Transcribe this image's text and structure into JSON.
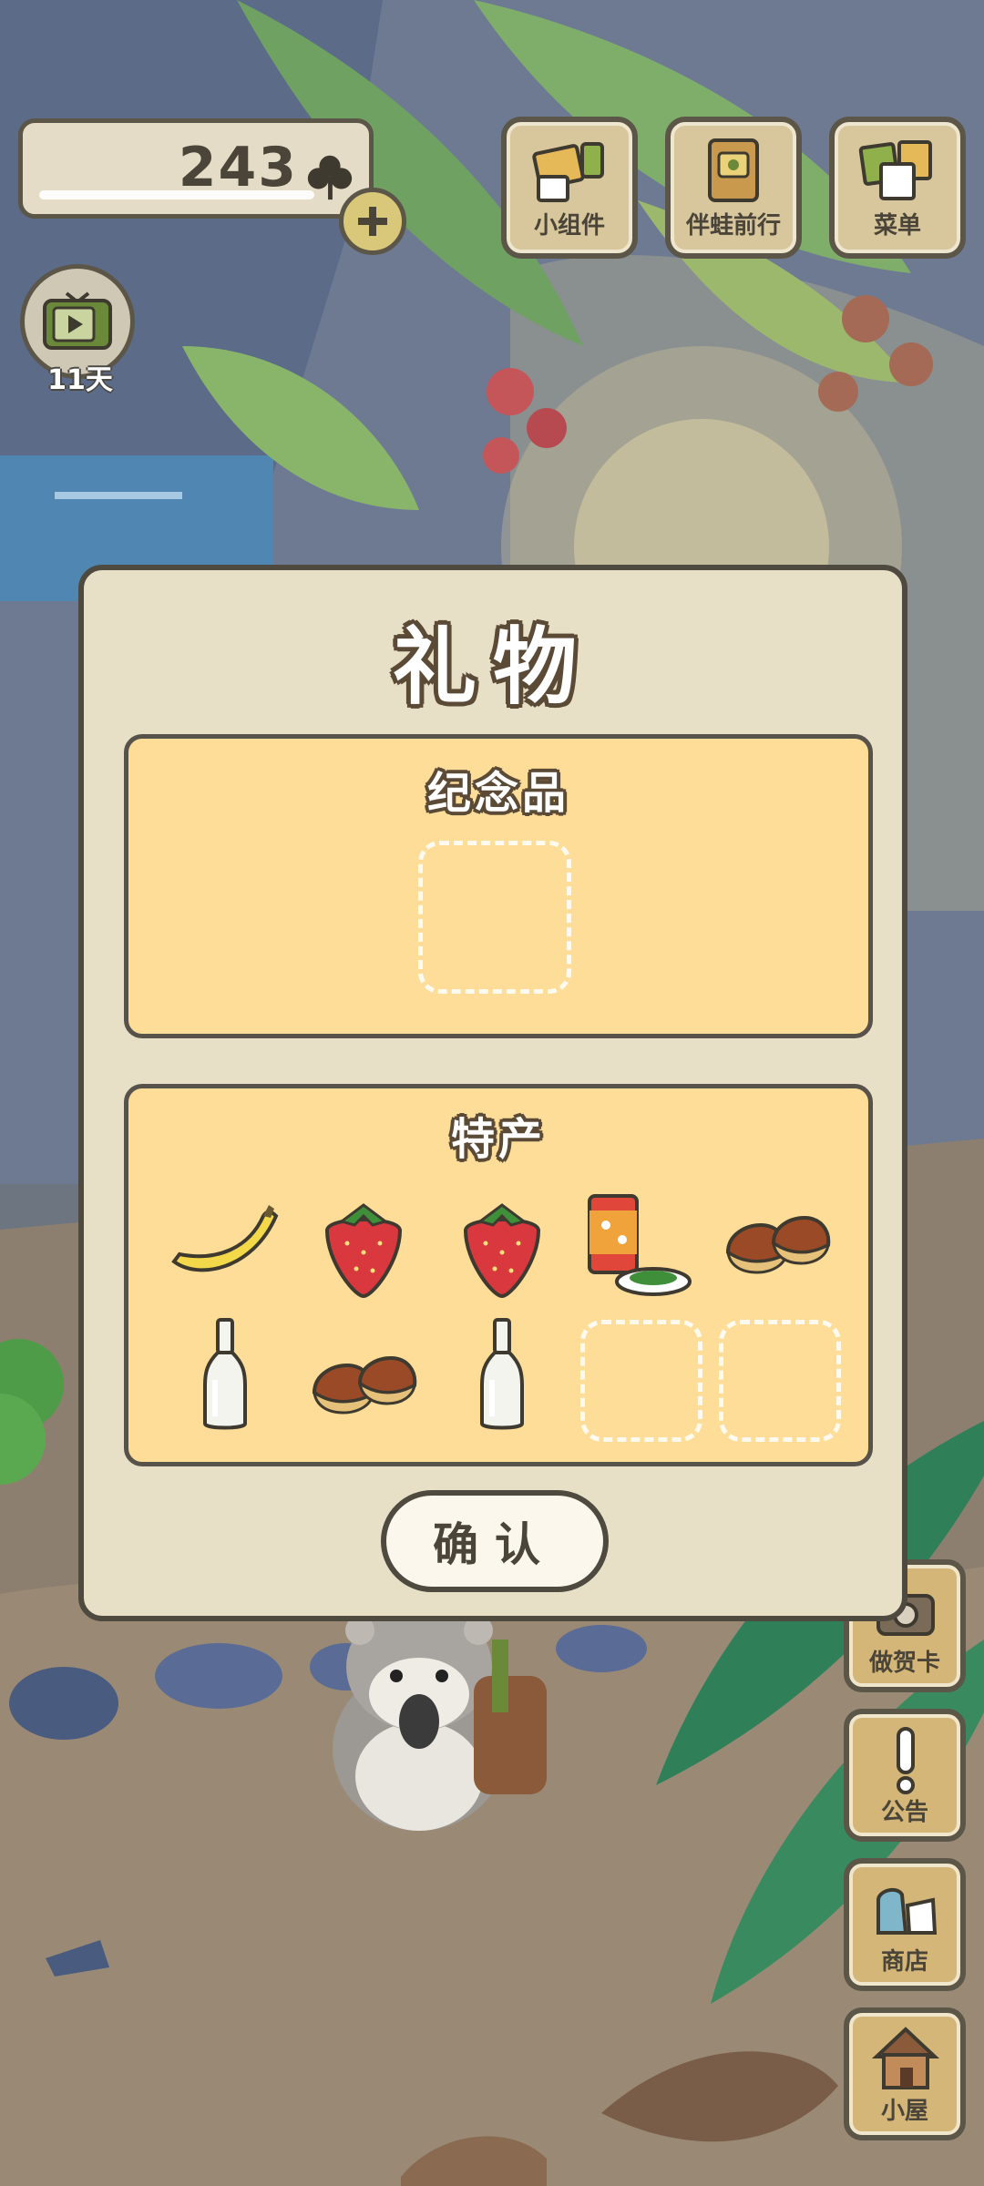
{
  "hud": {
    "clover_count": "243",
    "tv_days": "11天"
  },
  "top_buttons": [
    {
      "id": "widgets",
      "label": "小组件",
      "icon": "widget-icon"
    },
    {
      "id": "travel",
      "label": "伴蛙前行",
      "icon": "travel-book-icon"
    },
    {
      "id": "menu",
      "label": "菜单",
      "icon": "menu-cards-icon"
    }
  ],
  "side_buttons": [
    {
      "id": "card",
      "label": "做贺卡",
      "icon": "camera-icon"
    },
    {
      "id": "notice",
      "label": "公告",
      "icon": "exclamation-icon"
    },
    {
      "id": "shop",
      "label": "商店",
      "icon": "shop-bag-icon"
    },
    {
      "id": "house",
      "label": "小屋",
      "icon": "house-icon"
    }
  ],
  "dialog": {
    "title": "礼物",
    "souvenir_title": "纪念品",
    "specialty_title": "特产",
    "confirm_label": "确认"
  },
  "specialties": [
    "banana",
    "strawberry",
    "strawberry",
    "tea-tin-with-plate",
    "chestnuts",
    "glass-bottle",
    "chestnuts",
    "glass-bottle",
    "empty",
    "empty"
  ],
  "colors": {
    "dialog_bg": "#e7dfc6",
    "panel_bg": "#fddd97",
    "outline": "#4f4a3f"
  }
}
